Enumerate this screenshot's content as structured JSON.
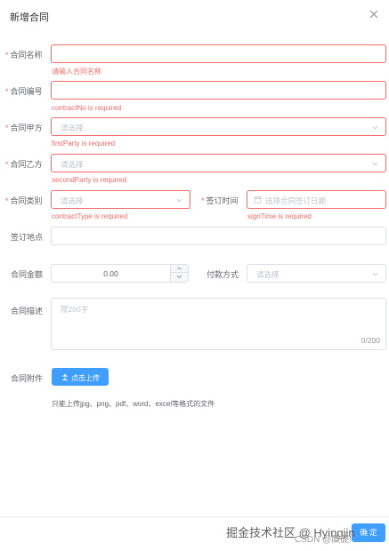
{
  "dialog": {
    "title": "新增合同"
  },
  "fields": {
    "name": {
      "label": "合同名称",
      "error": "请输入合同名称"
    },
    "number": {
      "label": "合同编号",
      "error": "contractNo is required"
    },
    "party_a": {
      "label": "合同甲方",
      "placeholder": "请选择",
      "error": "firstParty is required"
    },
    "party_b": {
      "label": "合同乙方",
      "placeholder": "请选择",
      "error": "secondParty is required"
    },
    "type": {
      "label": "合同类别",
      "placeholder": "请选择",
      "error": "contractType is required"
    },
    "sign_time": {
      "label": "签订时间",
      "placeholder": "选择合同签订日期",
      "error": "signTime is required"
    },
    "sign_place": {
      "label": "签订地点"
    },
    "amount": {
      "label": "合同金额",
      "value": "0.00"
    },
    "payment": {
      "label": "付款方式",
      "placeholder": "请选择"
    },
    "description": {
      "label": "合同描述",
      "placeholder": "限200字",
      "counter": "0/200"
    },
    "attachment": {
      "label": "合同附件",
      "button": "点击上传",
      "tip": "只能上传jpg、png、pdf、word、excel等格式的文件"
    }
  },
  "required_mark": "*",
  "footer": {
    "confirm": "确 定"
  },
  "watermark": {
    "main": "掘金技术社区 @ Hyingjin",
    "sub": "CSDN @麋鹿!"
  },
  "colors": {
    "primary": "#409eff",
    "danger": "#f56c6c",
    "border": "#dcdfe6",
    "placeholder": "#c0c4cc"
  },
  "icons": {
    "close": "close-icon",
    "chevron": "chevron-down-icon",
    "calendar": "calendar-icon",
    "upload": "upload-icon"
  }
}
